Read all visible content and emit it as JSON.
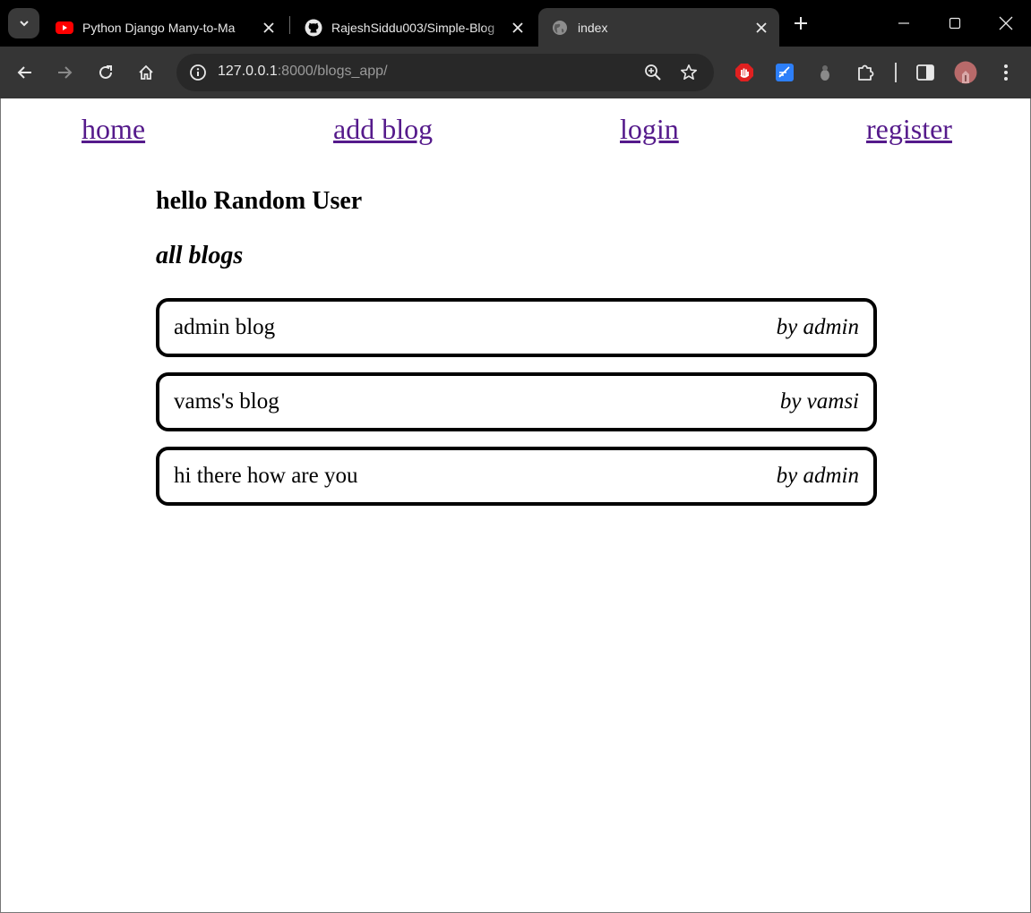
{
  "browser": {
    "tabs": [
      {
        "title": "Python Django Many-to-Ma",
        "icon": "youtube-icon"
      },
      {
        "title": "RajeshSiddu003/Simple-Blog",
        "icon": "github-icon"
      },
      {
        "title": "index",
        "icon": "globe-icon",
        "active": true
      }
    ],
    "url": {
      "host": "127.0.0.1",
      "rest": ":8000/blogs_app/"
    }
  },
  "nav": {
    "home": "home",
    "add_blog": "add blog",
    "login": "login",
    "register": "register"
  },
  "greeting": "hello Random User",
  "section_title": "all blogs",
  "blogs": [
    {
      "title": "admin blog",
      "author": "by admin"
    },
    {
      "title": "vams's blog",
      "author": "by vamsi"
    },
    {
      "title": "hi there how are you",
      "author": "by admin"
    }
  ],
  "colors": {
    "link": "#551a8b",
    "chrome_bg": "#353535",
    "tabstrip_bg": "#000000"
  }
}
